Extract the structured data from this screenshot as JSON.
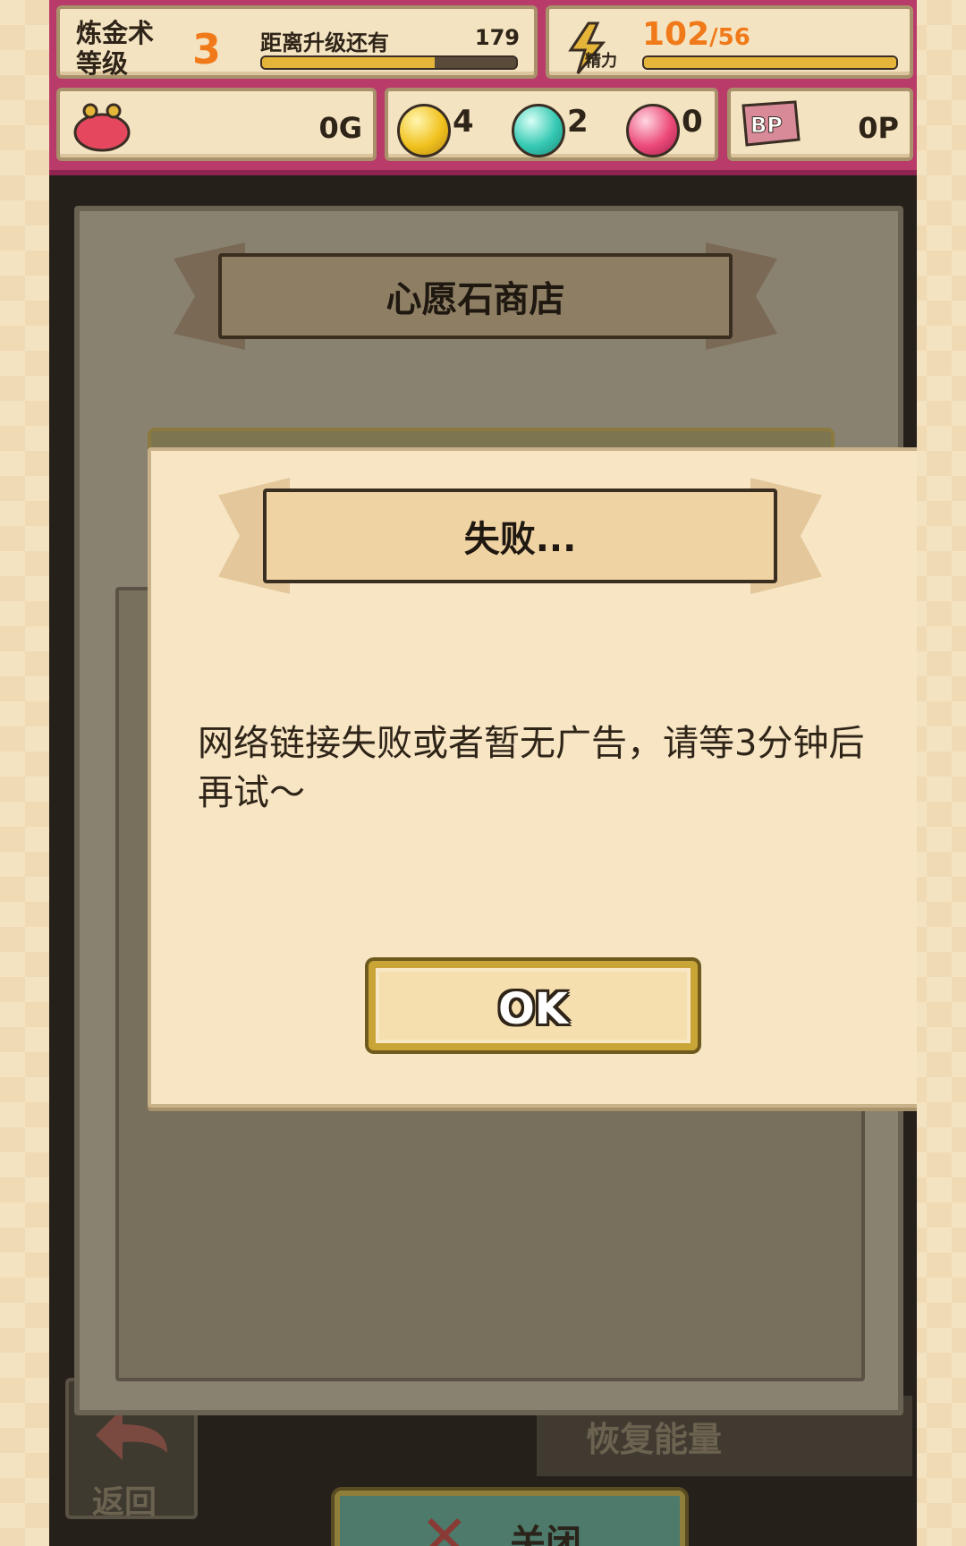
{
  "status": {
    "alchemy_level_label": "炼金术等级",
    "alchemy_level": "3",
    "next_level_label": "距离升级还有",
    "next_level_value": "179",
    "exp_progress": 0.68,
    "energy_label": "精力",
    "energy_value": "102",
    "energy_max": "/56",
    "energy_progress": 1.0,
    "gold": "0G",
    "gem_yellow": "4",
    "gem_teal": "2",
    "gem_pink": "0",
    "bp_label": "BP",
    "bp": "0P"
  },
  "background": {
    "back_label": "返回",
    "restore_label": "恢复能量"
  },
  "shop": {
    "title": "心愿石商店",
    "close_label": "关闭"
  },
  "modal": {
    "title": "失败...",
    "message": "网络链接失败或者暂无广告，请等3分钟后再试～",
    "ok_label": "OK"
  },
  "colors": {
    "accent_orange": "#f07a1a",
    "topbar_magenta": "#b93b6a",
    "gold_bar": "#e5b53a"
  }
}
